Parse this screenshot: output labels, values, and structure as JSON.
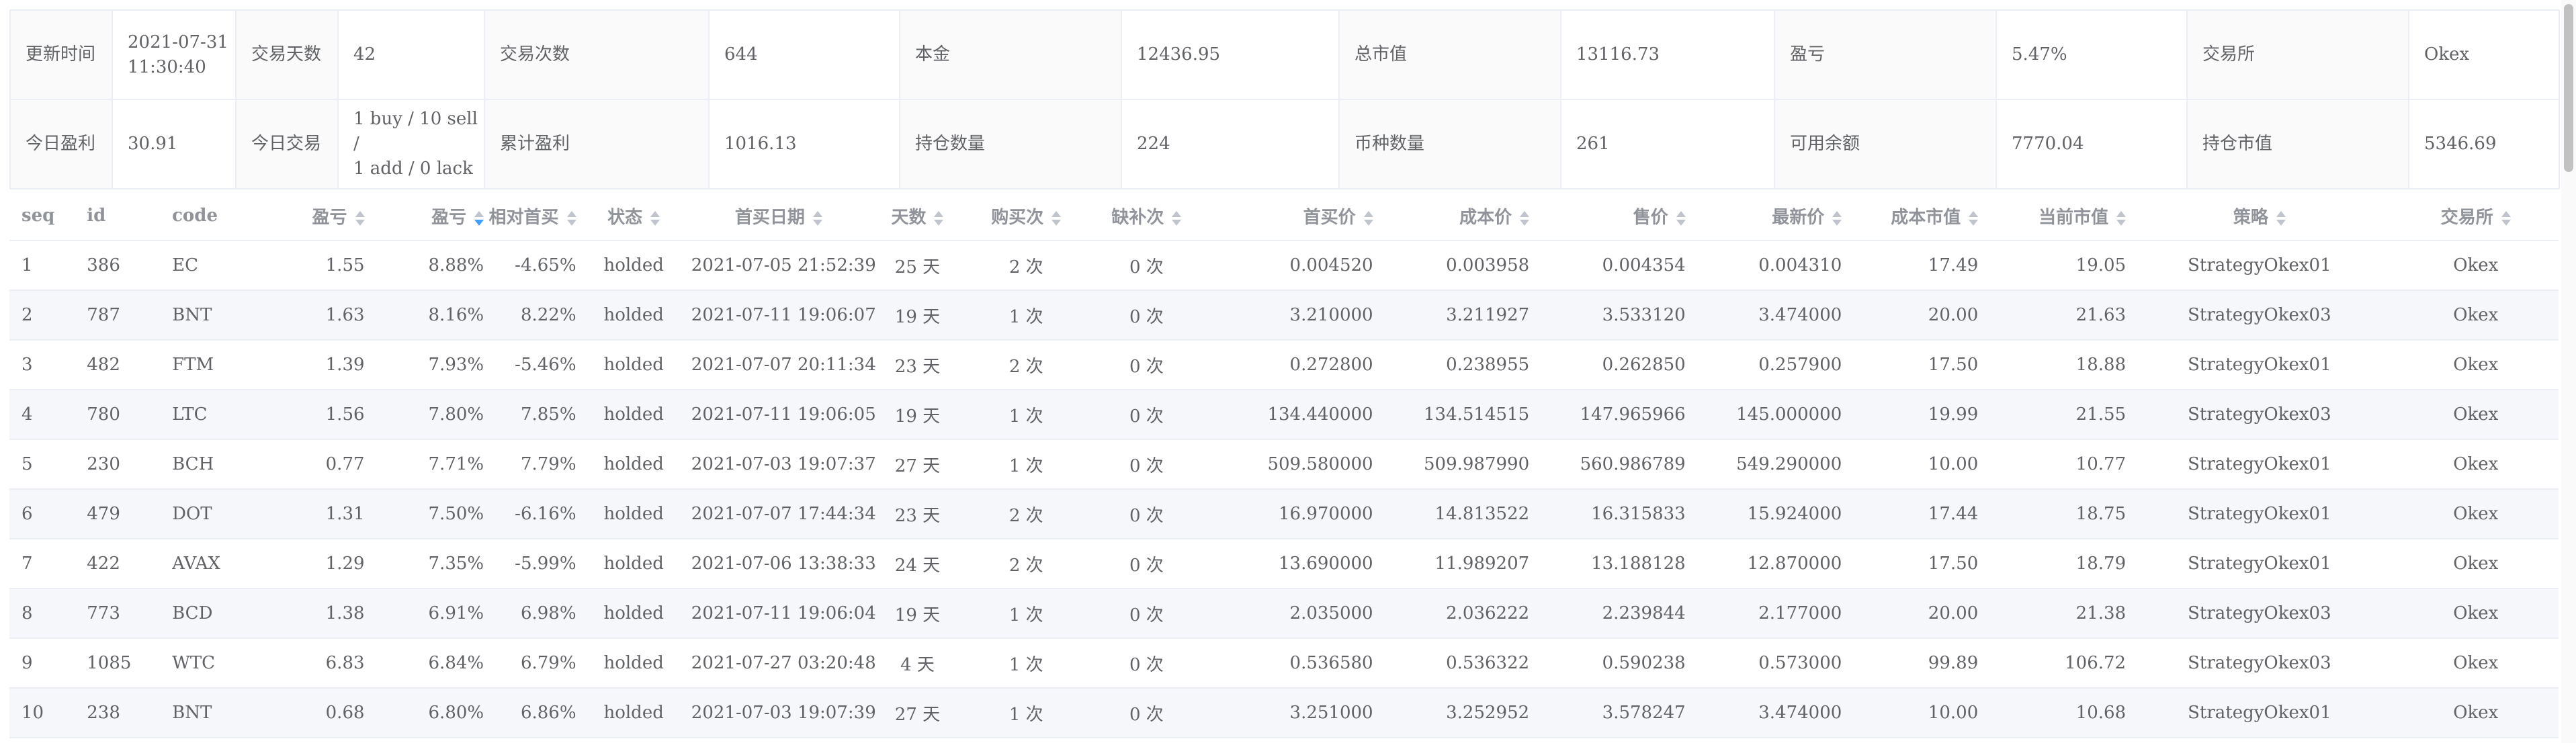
{
  "summary": {
    "row1": [
      {
        "label": "更新时间",
        "value": "2021-07-31\n11:30:40"
      },
      {
        "label": "交易天数",
        "value": "42"
      },
      {
        "label": "交易次数",
        "value": "644"
      },
      {
        "label": "本金",
        "value": "12436.95"
      },
      {
        "label": "总市值",
        "value": "13116.73"
      },
      {
        "label": "盈亏",
        "value": "5.47%"
      },
      {
        "label": "交易所",
        "value": "Okex"
      }
    ],
    "row2": [
      {
        "label": "今日盈利",
        "value": "30.91"
      },
      {
        "label": "今日交易",
        "value": "1 buy / 10 sell /\n1 add / 0 lack"
      },
      {
        "label": "累计盈利",
        "value": "1016.13"
      },
      {
        "label": "持仓数量",
        "value": "224"
      },
      {
        "label": "币种数量",
        "value": "261"
      },
      {
        "label": "可用余额",
        "value": "7770.04"
      },
      {
        "label": "持仓市值",
        "value": "5346.69"
      }
    ]
  },
  "table": {
    "columns": [
      "seq",
      "id",
      "code",
      "盈亏",
      "盈亏",
      "相对首买",
      "状态",
      "首买日期",
      "天数",
      "购买次",
      "缺补次",
      "首买价",
      "成本价",
      "售价",
      "最新价",
      "成本市值",
      "当前市值",
      "策略",
      "交易所"
    ],
    "sort_active_column": 4,
    "sort_direction": "descending",
    "rows": [
      [
        "1",
        "386",
        "EC",
        "1.55",
        "8.88%",
        "-4.65%",
        "holded",
        "2021-07-05 21:52:39",
        "25 天",
        "2 次",
        "0 次",
        "0.004520",
        "0.003958",
        "0.004354",
        "0.004310",
        "17.49",
        "19.05",
        "StrategyOkex01",
        "Okex"
      ],
      [
        "2",
        "787",
        "BNT",
        "1.63",
        "8.16%",
        "8.22%",
        "holded",
        "2021-07-11 19:06:07",
        "19 天",
        "1 次",
        "0 次",
        "3.210000",
        "3.211927",
        "3.533120",
        "3.474000",
        "20.00",
        "21.63",
        "StrategyOkex03",
        "Okex"
      ],
      [
        "3",
        "482",
        "FTM",
        "1.39",
        "7.93%",
        "-5.46%",
        "holded",
        "2021-07-07 20:11:34",
        "23 天",
        "2 次",
        "0 次",
        "0.272800",
        "0.238955",
        "0.262850",
        "0.257900",
        "17.50",
        "18.88",
        "StrategyOkex01",
        "Okex"
      ],
      [
        "4",
        "780",
        "LTC",
        "1.56",
        "7.80%",
        "7.85%",
        "holded",
        "2021-07-11 19:06:05",
        "19 天",
        "1 次",
        "0 次",
        "134.440000",
        "134.514515",
        "147.965966",
        "145.000000",
        "19.99",
        "21.55",
        "StrategyOkex03",
        "Okex"
      ],
      [
        "5",
        "230",
        "BCH",
        "0.77",
        "7.71%",
        "7.79%",
        "holded",
        "2021-07-03 19:07:37",
        "27 天",
        "1 次",
        "0 次",
        "509.580000",
        "509.987990",
        "560.986789",
        "549.290000",
        "10.00",
        "10.77",
        "StrategyOkex01",
        "Okex"
      ],
      [
        "6",
        "479",
        "DOT",
        "1.31",
        "7.50%",
        "-6.16%",
        "holded",
        "2021-07-07 17:44:34",
        "23 天",
        "2 次",
        "0 次",
        "16.970000",
        "14.813522",
        "16.315833",
        "15.924000",
        "17.44",
        "18.75",
        "StrategyOkex01",
        "Okex"
      ],
      [
        "7",
        "422",
        "AVAX",
        "1.29",
        "7.35%",
        "-5.99%",
        "holded",
        "2021-07-06 13:38:33",
        "24 天",
        "2 次",
        "0 次",
        "13.690000",
        "11.989207",
        "13.188128",
        "12.870000",
        "17.50",
        "18.79",
        "StrategyOkex01",
        "Okex"
      ],
      [
        "8",
        "773",
        "BCD",
        "1.38",
        "6.91%",
        "6.98%",
        "holded",
        "2021-07-11 19:06:04",
        "19 天",
        "1 次",
        "0 次",
        "2.035000",
        "2.036222",
        "2.239844",
        "2.177000",
        "20.00",
        "21.38",
        "StrategyOkex03",
        "Okex"
      ],
      [
        "9",
        "1085",
        "WTC",
        "6.83",
        "6.84%",
        "6.79%",
        "holded",
        "2021-07-27 03:20:48",
        "4 天",
        "1 次",
        "0 次",
        "0.536580",
        "0.536322",
        "0.590238",
        "0.573000",
        "99.89",
        "106.72",
        "StrategyOkex03",
        "Okex"
      ],
      [
        "10",
        "238",
        "BNT",
        "0.68",
        "6.80%",
        "6.86%",
        "holded",
        "2021-07-03 19:07:39",
        "27 天",
        "1 次",
        "0 次",
        "3.251000",
        "3.252952",
        "3.578247",
        "3.474000",
        "10.00",
        "10.68",
        "StrategyOkex01",
        "Okex"
      ]
    ]
  },
  "colors": {
    "profit_text": "#ff0000",
    "status_text": "#0000ff",
    "sort_active": "#409eff",
    "border": "#ebeef5",
    "stripe": "#f5f7fa"
  }
}
